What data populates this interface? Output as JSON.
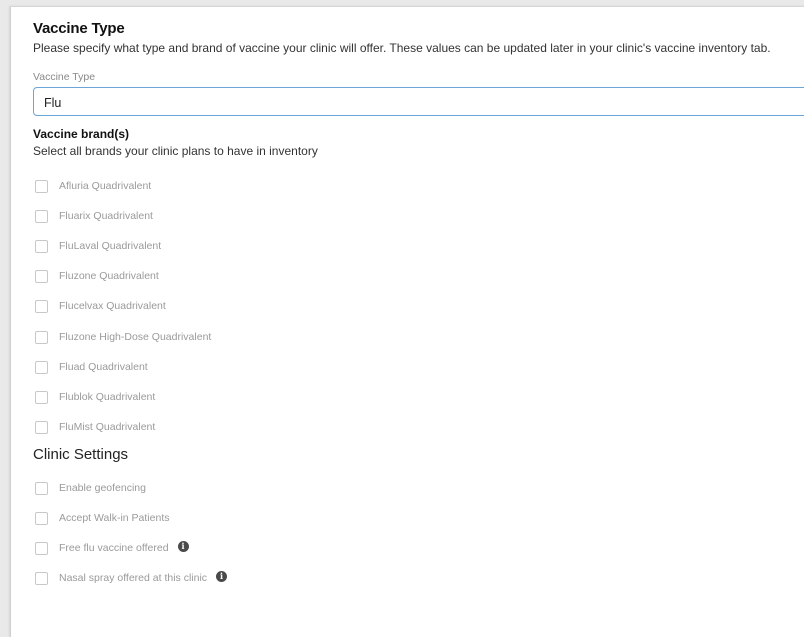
{
  "vaccine_type_section": {
    "title": "Vaccine Type",
    "description": "Please specify what type and brand of vaccine your clinic will offer. These values can be updated later in your clinic's vaccine inventory tab.",
    "field_label": "Vaccine Type",
    "selected_value": "Flu"
  },
  "brands_section": {
    "title": "Vaccine brand(s)",
    "description": "Select all brands your clinic plans to have in inventory",
    "items": [
      {
        "label": "Afluria Quadrivalent",
        "checked": false
      },
      {
        "label": "Fluarix Quadrivalent",
        "checked": false
      },
      {
        "label": "FluLaval Quadrivalent",
        "checked": false
      },
      {
        "label": "Fluzone Quadrivalent",
        "checked": false
      },
      {
        "label": "Flucelvax Quadrivalent",
        "checked": false
      },
      {
        "label": "Fluzone High-Dose Quadrivalent",
        "checked": false
      },
      {
        "label": "Fluad Quadrivalent",
        "checked": false
      },
      {
        "label": "Flublok Quadrivalent",
        "checked": false
      },
      {
        "label": "FluMist Quadrivalent",
        "checked": false
      }
    ]
  },
  "clinic_settings": {
    "title": "Clinic Settings",
    "items": [
      {
        "label": "Enable geofencing",
        "checked": false,
        "info": false
      },
      {
        "label": "Accept Walk-in Patients",
        "checked": false,
        "info": false
      },
      {
        "label": "Free flu vaccine offered",
        "checked": false,
        "info": true
      },
      {
        "label": "Nasal spray offered at this clinic",
        "checked": false,
        "info": true
      }
    ],
    "info_icon_glyph": "i"
  }
}
